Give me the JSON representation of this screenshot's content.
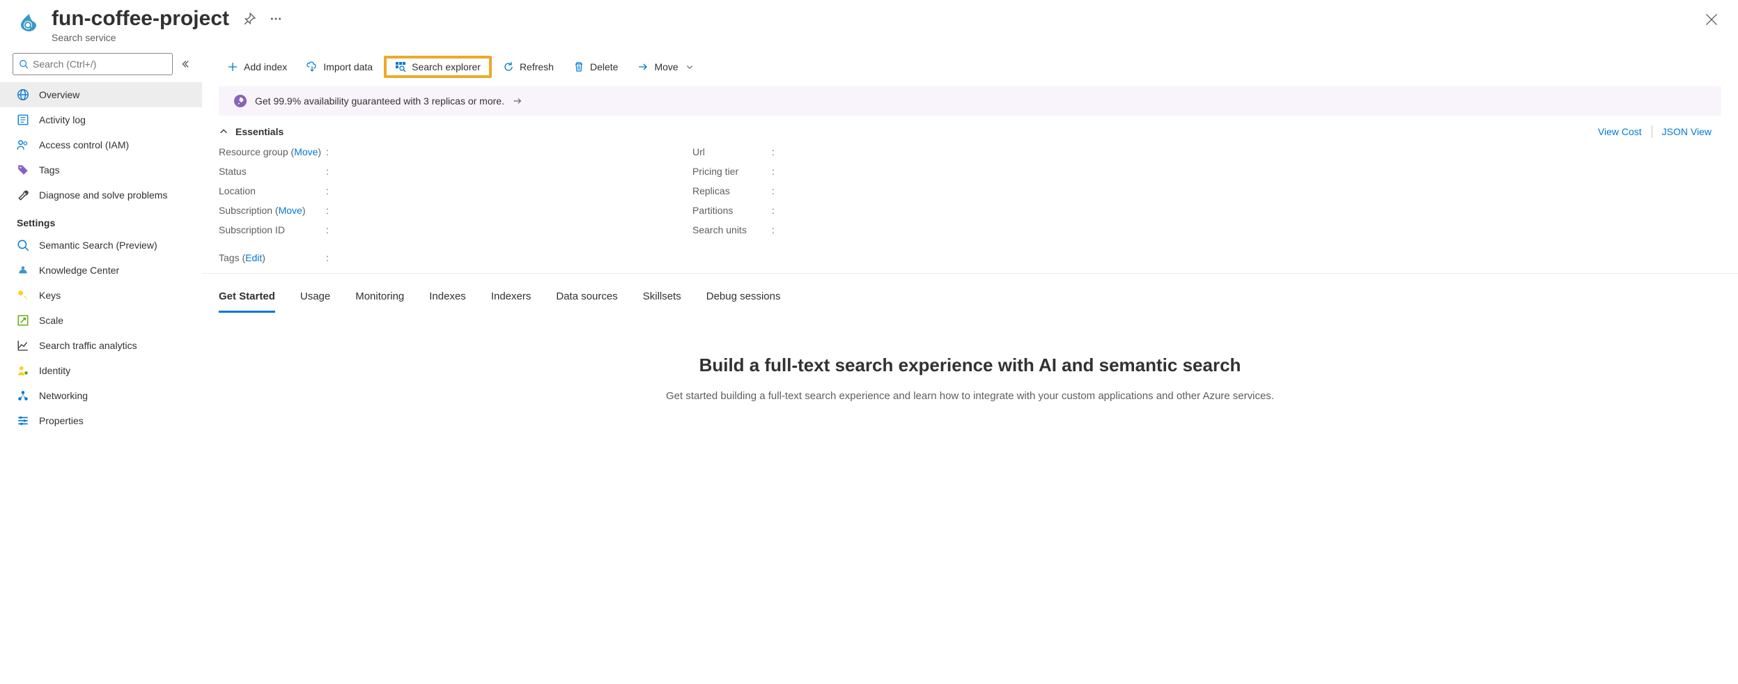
{
  "header": {
    "title": "fun-coffee-project",
    "subtitle": "Search service"
  },
  "sidebar": {
    "search_placeholder": "Search (Ctrl+/)",
    "items_primary": [
      {
        "label": "Overview",
        "icon": "globe",
        "selected": true
      },
      {
        "label": "Activity log",
        "icon": "log",
        "selected": false
      },
      {
        "label": "Access control (IAM)",
        "icon": "people",
        "selected": false
      },
      {
        "label": "Tags",
        "icon": "tag",
        "selected": false
      },
      {
        "label": "Diagnose and solve problems",
        "icon": "wrench",
        "selected": false
      }
    ],
    "section_settings": "Settings",
    "items_settings": [
      {
        "label": "Semantic Search (Preview)",
        "icon": "search"
      },
      {
        "label": "Knowledge Center",
        "icon": "knowledge"
      },
      {
        "label": "Keys",
        "icon": "key"
      },
      {
        "label": "Scale",
        "icon": "scale"
      },
      {
        "label": "Search traffic analytics",
        "icon": "chart"
      },
      {
        "label": "Identity",
        "icon": "identity"
      },
      {
        "label": "Networking",
        "icon": "network"
      },
      {
        "label": "Properties",
        "icon": "properties"
      }
    ]
  },
  "toolbar": {
    "add_index": "Add index",
    "import_data": "Import data",
    "search_explorer": "Search explorer",
    "refresh": "Refresh",
    "delete": "Delete",
    "move": "Move"
  },
  "infobar": {
    "text": "Get 99.9% availability guaranteed with 3 replicas or more."
  },
  "essentials": {
    "title": "Essentials",
    "view_cost": "View Cost",
    "json_view": "JSON View",
    "left": [
      {
        "label": "Resource group",
        "suffix_link": "Move"
      },
      {
        "label": "Status"
      },
      {
        "label": "Location"
      },
      {
        "label": "Subscription",
        "suffix_link": "Move"
      },
      {
        "label": "Subscription ID"
      }
    ],
    "right": [
      {
        "label": "Url"
      },
      {
        "label": "Pricing tier"
      },
      {
        "label": "Replicas"
      },
      {
        "label": "Partitions"
      },
      {
        "label": "Search units"
      }
    ],
    "tags_label": "Tags",
    "tags_link": "Edit"
  },
  "tabs": [
    {
      "label": "Get Started",
      "active": true
    },
    {
      "label": "Usage"
    },
    {
      "label": "Monitoring"
    },
    {
      "label": "Indexes"
    },
    {
      "label": "Indexers"
    },
    {
      "label": "Data sources"
    },
    {
      "label": "Skillsets"
    },
    {
      "label": "Debug sessions"
    }
  ],
  "hero": {
    "title": "Build a full-text search experience with AI and semantic search",
    "subtitle": "Get started building a full-text search experience and learn how to integrate with your custom applications and other Azure services."
  }
}
